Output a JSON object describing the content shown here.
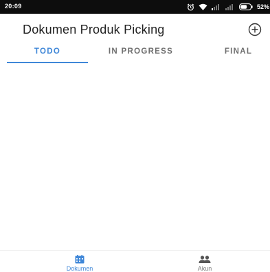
{
  "status_bar": {
    "time": "20:09",
    "battery": "52%"
  },
  "header": {
    "title": "Dokumen Produk Picking",
    "add_icon": "plus-circle-icon"
  },
  "tabs": [
    {
      "label": "TODO",
      "active": true
    },
    {
      "label": "IN PROGRESS",
      "active": false
    },
    {
      "label": "FINAL",
      "active": false
    }
  ],
  "bottom_nav": [
    {
      "label": "Dokumen",
      "icon": "calendar-icon",
      "active": true
    },
    {
      "label": "Akun",
      "icon": "people-icon",
      "active": false
    }
  ],
  "colors": {
    "accent": "#3f87d8",
    "status_bar": "#0d0d0d",
    "inactive_text": "#6f6f6f"
  }
}
